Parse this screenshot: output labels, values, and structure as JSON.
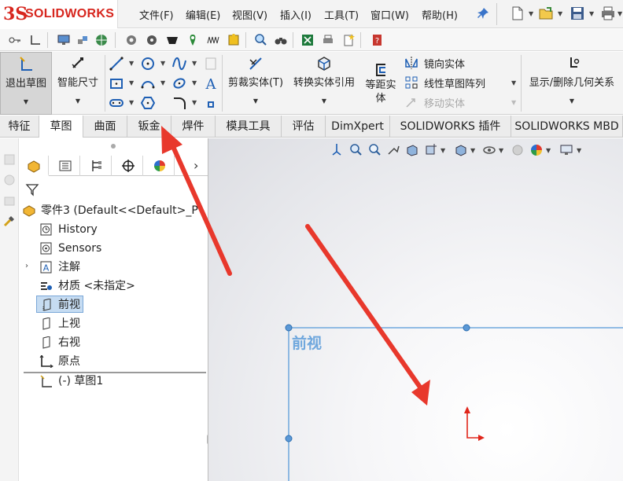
{
  "app": {
    "logo_ds": "3S",
    "logo_text": "SOLIDWORKS"
  },
  "menu": [
    "文件(F)",
    "编辑(E)",
    "视图(V)",
    "插入(I)",
    "工具(T)",
    "窗口(W)",
    "帮助(H)"
  ],
  "command_manager": {
    "exit_sketch": "退出草图",
    "smart_dimension": "智能尺寸",
    "trim_entities": "剪裁实体(T)",
    "convert_entities": "转换实体引用",
    "offset_entities": "等距实体",
    "mirror_entities": "镜向实体",
    "linear_pattern": "线性草图阵列",
    "move_entities": "移动实体",
    "display_relations": "显示/删除几何关系"
  },
  "tabs": [
    "特征",
    "草图",
    "曲面",
    "钣金",
    "焊件",
    "模具工具",
    "评估",
    "DimXpert",
    "SOLIDWORKS 插件",
    "SOLIDWORKS MBD"
  ],
  "active_tab": "草图",
  "feature_tree": {
    "root": "零件3  (Default<<Default>_P",
    "items": [
      {
        "label": "History",
        "icon": "history-icon"
      },
      {
        "label": "Sensors",
        "icon": "sensors-icon"
      },
      {
        "label": "注解",
        "icon": "annotations-icon"
      },
      {
        "label": "材质 <未指定>",
        "icon": "material-icon"
      },
      {
        "label": "前视",
        "icon": "plane-icon",
        "selected": true
      },
      {
        "label": "上视",
        "icon": "plane-icon"
      },
      {
        "label": "右视",
        "icon": "plane-icon"
      },
      {
        "label": "原点",
        "icon": "origin-icon"
      },
      {
        "label": "(-) 草图1",
        "icon": "sketch-icon"
      }
    ]
  },
  "viewport": {
    "plane_label": "前视"
  },
  "colors": {
    "accent_red": "#e8382c",
    "plane_blue": "#6fa7dd",
    "logo_red": "#d7261e"
  }
}
